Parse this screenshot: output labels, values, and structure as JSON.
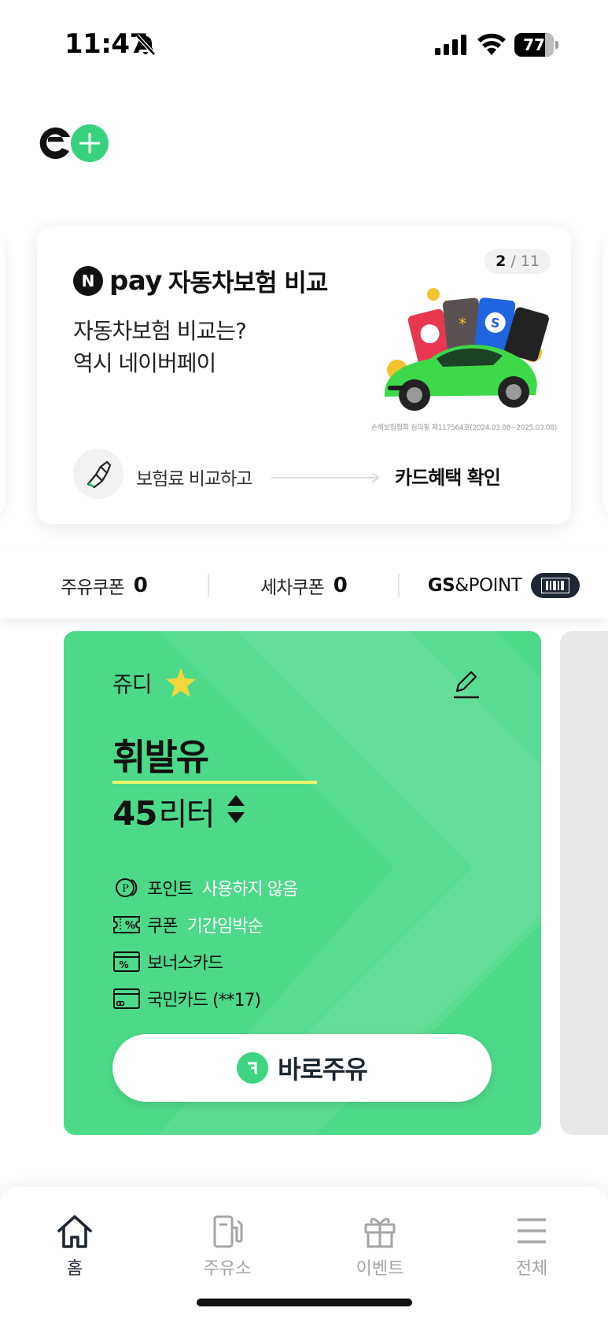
{
  "status_bar": {
    "time": "11:47",
    "battery": "77",
    "battery_level": 0.77
  },
  "banner": {
    "pager_current": "2",
    "pager_total": "11",
    "brand_letter": "N",
    "brand_word": "pay",
    "title": "자동차보험 비교",
    "description": "자동차보험 비교는?\n역시 네이버페이",
    "fine_print": "손해보험협회 심의필 제117564호(2024.03.08~2025.03.08)",
    "step_from": "보험료 비교하고",
    "step_to": "카드혜택 확인"
  },
  "coupons": {
    "fuel_label": "주유쿠폰",
    "fuel_count": "0",
    "wash_label": "세차쿠폰",
    "wash_count": "0",
    "gs_bold": "GS",
    "gs_rest": "&POINT"
  },
  "card": {
    "name": "쥬디",
    "fuel_type": "휘발유",
    "amount": "45",
    "unit": "리터",
    "options": [
      {
        "label": "포인트",
        "value": "사용하지 않음"
      },
      {
        "label": "쿠폰",
        "value": "기간임박순"
      },
      {
        "label": "보너스카드",
        "value": ""
      },
      {
        "label": "국민카드 (**17)",
        "value": ""
      }
    ],
    "cta": "바로주유"
  },
  "nav": [
    {
      "label": "홈",
      "icon": "home-icon",
      "active": true
    },
    {
      "label": "주유소",
      "icon": "fuel-pump-icon",
      "active": false
    },
    {
      "label": "이벤트",
      "icon": "gift-icon",
      "active": false
    },
    {
      "label": "전체",
      "icon": "menu-icon",
      "active": false
    }
  ],
  "colors": {
    "card_green": "#4cd98a",
    "accent_yellow": "#e8f76a",
    "dark_navy": "#1e2733"
  }
}
